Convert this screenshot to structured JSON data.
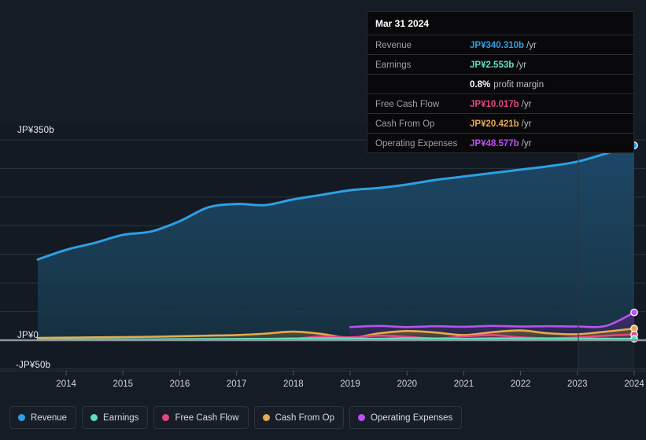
{
  "chart_data": {
    "type": "area",
    "title": "",
    "xlabel": "",
    "ylabel": "",
    "ylim": [
      -50,
      350
    ],
    "y_unit": "JP¥b",
    "grid": true,
    "legend_position": "bottom-left",
    "y_ticks": [
      "JP¥350b",
      "JP¥0",
      "-JP¥50b"
    ],
    "y_tick_values": [
      350,
      0,
      -50
    ],
    "x_ticks": [
      "2014",
      "2015",
      "2016",
      "2017",
      "2018",
      "2019",
      "2020",
      "2021",
      "2022",
      "2023",
      "2024"
    ],
    "x": [
      2013.5,
      2014,
      2014.5,
      2015,
      2015.5,
      2016,
      2016.5,
      2017,
      2017.5,
      2018,
      2018.5,
      2019,
      2019.5,
      2020,
      2020.5,
      2021,
      2021.5,
      2022,
      2022.5,
      2023,
      2023.5,
      2024
    ],
    "series": [
      {
        "name": "Revenue",
        "color": "#2e9fe3",
        "values": [
          141,
          158,
          170,
          184,
          190,
          208,
          232,
          238,
          236,
          246,
          254,
          262,
          266,
          272,
          280,
          286,
          292,
          298,
          304,
          312,
          326,
          340.31
        ]
      },
      {
        "name": "Earnings",
        "color": "#5ce0c4",
        "values": [
          1.0,
          1.2,
          1.3,
          1.4,
          1.5,
          1.8,
          2.0,
          2.2,
          2.4,
          3.0,
          3.2,
          3.0,
          2.6,
          3.4,
          3.0,
          2.4,
          3.2,
          3.0,
          2.6,
          2.8,
          2.6,
          2.553
        ]
      },
      {
        "name": "Free Cash Flow",
        "color": "#e8457f",
        "values": [
          null,
          null,
          null,
          null,
          null,
          null,
          null,
          null,
          null,
          2.0,
          6.5,
          5.0,
          8.0,
          6.0,
          3.0,
          6.5,
          9.0,
          5.0,
          3.5,
          5.0,
          8.0,
          10.017
        ]
      },
      {
        "name": "Cash From Op",
        "color": "#e8a84c",
        "values": [
          4.0,
          4.5,
          5.0,
          5.5,
          6.0,
          7.0,
          8.0,
          9.0,
          11.5,
          15.0,
          11.0,
          4.0,
          12.0,
          16.0,
          13.5,
          9.0,
          14.0,
          17.0,
          12.0,
          10.5,
          15.0,
          20.421
        ]
      },
      {
        "name": "Operating Expenses",
        "color": "#bb52ef",
        "values": [
          null,
          null,
          null,
          null,
          null,
          null,
          null,
          null,
          null,
          null,
          null,
          23.0,
          25.0,
          23.0,
          24.5,
          23.5,
          25.0,
          24.0,
          24.5,
          24.0,
          25.0,
          48.577
        ]
      }
    ]
  },
  "tooltip": {
    "date": "Mar 31 2024",
    "rows": [
      {
        "label": "Revenue",
        "value": "JP¥340.310b",
        "unit": "/yr",
        "color": "#2e9fe3"
      },
      {
        "label": "Earnings",
        "value": "JP¥2.553b",
        "unit": "/yr",
        "color": "#5ce0c4"
      },
      {
        "label": "",
        "value": "0.8%",
        "unit": "profit margin",
        "color": "#ffffff"
      },
      {
        "label": "Free Cash Flow",
        "value": "JP¥10.017b",
        "unit": "/yr",
        "color": "#e8457f"
      },
      {
        "label": "Cash From Op",
        "value": "JP¥20.421b",
        "unit": "/yr",
        "color": "#e8a84c"
      },
      {
        "label": "Operating Expenses",
        "value": "JP¥48.577b",
        "unit": "/yr",
        "color": "#bb52ef"
      }
    ]
  },
  "legend": {
    "items": [
      {
        "label": "Revenue",
        "color": "#2e9fe3"
      },
      {
        "label": "Earnings",
        "color": "#5ce0c4"
      },
      {
        "label": "Free Cash Flow",
        "color": "#e8457f"
      },
      {
        "label": "Cash From Op",
        "color": "#e8a84c"
      },
      {
        "label": "Operating Expenses",
        "color": "#bb52ef"
      }
    ]
  },
  "axis": {
    "y_top_label": "JP¥350b",
    "y_zero_label": "JP¥0",
    "y_bottom_label": "-JP¥50b"
  }
}
